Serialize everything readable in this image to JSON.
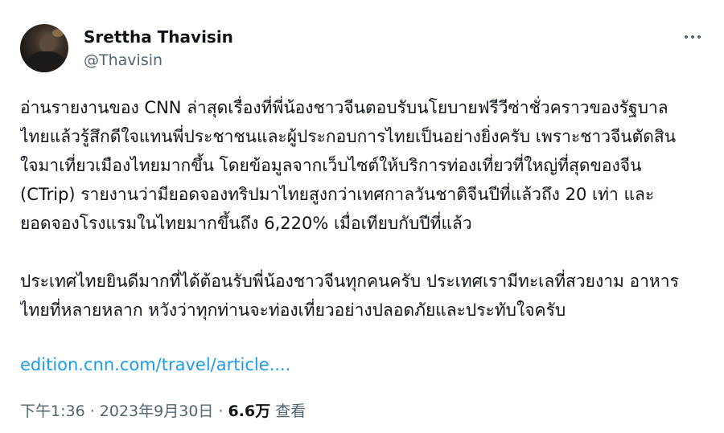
{
  "author": {
    "display_name": "Srettha Thavisin",
    "handle": "@Thavisin"
  },
  "tweet": {
    "paragraph_1": [
      "อ่านรายงานของ CNN ล่าสุดเรื่องที่พี่น้องชาวจีนตอบรับนโยบายฟรีวีซ่าชั่วคราวของรัฐบาล",
      "ไทยแล้วรู้สึกดีใจแทนพี่ประชาชนและผู้ประกอบการไทยเป็นอย่างยิ่งครับ เพราะชาวจีนตัดสิน",
      "ใจมาเที่ยวเมืองไทยมากขึ้น โดยข้อมูลจากเว็บไซต์ให้บริการท่องเที่ยวที่ใหญ่ที่สุดของจีน",
      "(CTrip) รายงานว่ามียอดจองทริปมาไทยสูงกว่าเทศกาลวันชาติจีนปีที่แล้วถึง 20 เท่า และ",
      "ยอดจองโรงแรมในไทยมากขึ้นถึง 6,220% เมื่อเทียบกับปีที่แล้ว"
    ],
    "paragraph_2": [
      "ประเทศไทยยินดีมากที่ได้ต้อนรับพี่น้องชาวจีนทุกคนครับ ประเทศเรามีทะเลที่สวยงาม อาหาร",
      "ไทยที่หลายหลาก หวังว่าทุกท่านจะท่องเที่ยวอย่างปลอดภัยและประทับใจครับ"
    ],
    "link": "edition.cnn.com/travel/article...."
  },
  "meta": {
    "time": "下午1:36",
    "separator": " · ",
    "date": "2023年9月30日",
    "views_count": "6.6万",
    "views_label": " 查看"
  },
  "colors": {
    "text": "#0f1419",
    "secondary": "#536471",
    "link": "#1d9bf0"
  },
  "icons": {
    "more": "more-horizontal-icon"
  }
}
